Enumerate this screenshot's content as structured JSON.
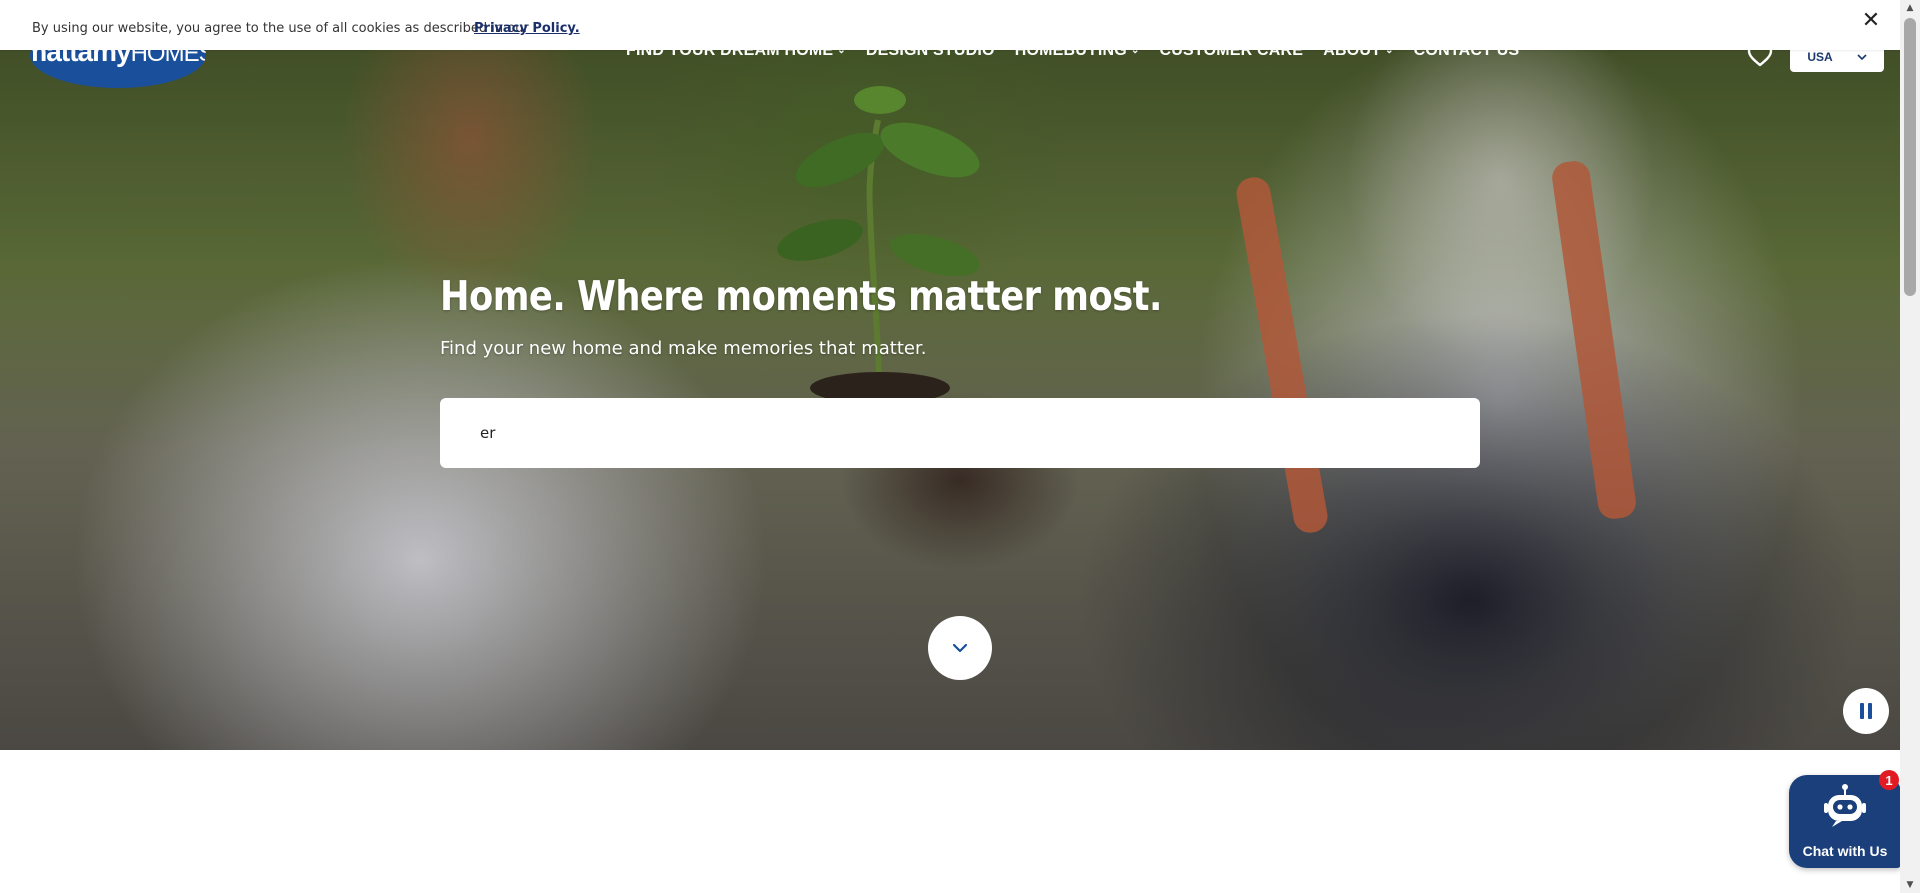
{
  "cookie_banner": {
    "text": "By using our website, you agree to the use of all cookies as described in our",
    "link_label": "Privacy Policy.",
    "close_label": "✕"
  },
  "header": {
    "logo_text_bold": "mattamy",
    "logo_text_light": "HOMES",
    "nav": [
      {
        "label": "FIND YOUR DREAM HOME",
        "has_dropdown": true
      },
      {
        "label": "DESIGN STUDIO",
        "has_dropdown": false
      },
      {
        "label": "HOMEBUYING",
        "has_dropdown": true
      },
      {
        "label": "CUSTOMER CARE",
        "has_dropdown": false
      },
      {
        "label": "ABOUT",
        "has_dropdown": true
      },
      {
        "label": "CONTACT US",
        "has_dropdown": false
      }
    ],
    "favorites_icon": "heart-icon",
    "country": {
      "selected": "USA"
    }
  },
  "hero": {
    "title": "Home. Where moments matter most.",
    "subtitle": "Find your new home and make memories that matter.",
    "search": {
      "value": "er"
    },
    "scroll_down_icon": "chevron-down-icon",
    "pause_icon": "pause-icon"
  },
  "chat": {
    "label": "Chat with Us",
    "badge_count": "1",
    "icon": "chatbot-icon"
  },
  "colors": {
    "brand_blue": "#1a4f9c",
    "chat_blue": "#1a3f7a",
    "badge_red": "#e01b24",
    "link_navy": "#1a2f6b"
  }
}
